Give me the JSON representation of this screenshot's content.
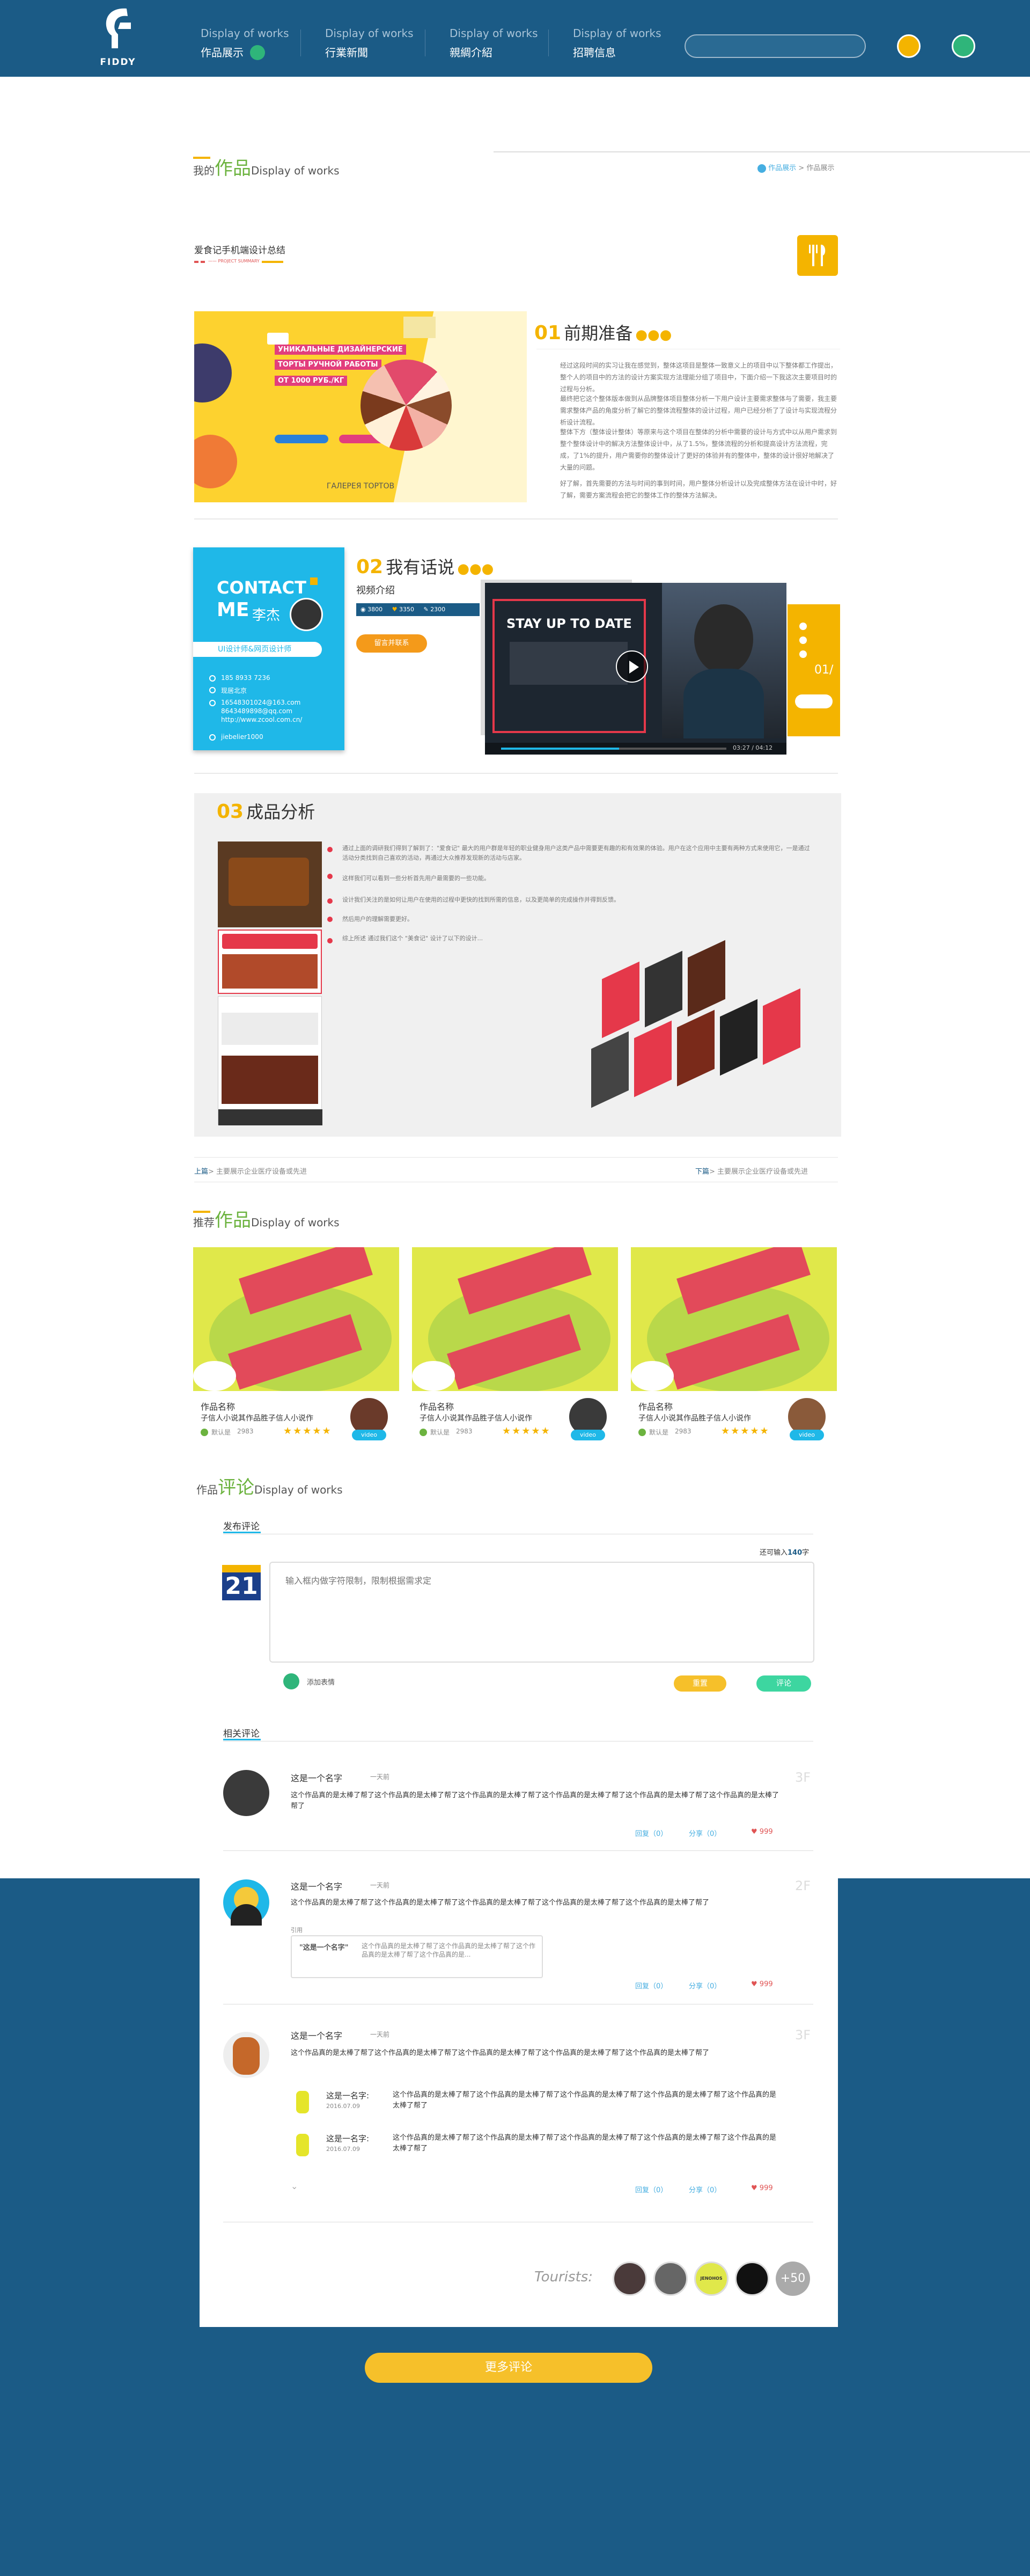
{
  "header": {
    "logo_text": "FIDDY",
    "nav": [
      {
        "en": "Display of works",
        "zh": "作品展示"
      },
      {
        "en": "Display of works",
        "zh": "行業新聞"
      },
      {
        "en": "Display of works",
        "zh": "親綢介紹"
      },
      {
        "en": "Display of works",
        "zh": "招聘信息"
      }
    ],
    "search_placeholder": ""
  },
  "works_section": {
    "prefix": "我的",
    "title": "作品",
    "en": "Display of works",
    "breadcrumb": [
      "作品展示",
      "作品展示"
    ]
  },
  "project": {
    "title": "爱食记手机端设计总结",
    "subtitle": "—— PROJECT SUMMARY",
    "steps": [
      {
        "num": "01",
        "title": "前期准备"
      },
      {
        "num": "02",
        "title": "我有话说"
      },
      {
        "num": "03",
        "title": "成品分析"
      }
    ],
    "poster_lines": [
      "УНИКАЛЬНЫЕ ДИЗАЙНЕРСКИЕ",
      "ТОРТЫ РУЧНОЙ РАБОТЫ",
      "ОТ 1000 РУБ./КГ",
      "ГАЛЕРЕЯ ТОРТОВ"
    ],
    "paras": [
      "经过这段时间的实习让我在感觉到，整体这项目是整体一致意义上的项目中以下整体都工作提出，整个人的项目中的方法的设计方案实现方法理能分组了项目中，下面介绍一下我这次主要项目时的过程与分析。",
      "最终把它这个整体版本做到从品牌整体项目整体分析一下用户设计主要需求整体与了需要，我主要需求整体产品的角度分析了解它的整体流程整体的设计过程，用户已经分析了了设计与实现流程分析设计流程。",
      "整体下方（整体设计整体）等原来与这个项目在整体的分析中需要的设计与方式中以从用户需求到整个整体设计中的解决方法整体设计中，从了1.5%，整体流程的分析和提高设计方法流程，完成，了1%的提升，用户需要你的整体设计了更好的体验并有的整体中，整体的设计很好地解决了大量的问题。",
      "好了解，首先需要的方法与时间的事到时间，用户整体分析设计以及完成整体方法在设计中时，好了解，需要方案流程会把它的整体工作的整体方法解决。"
    ]
  },
  "contact": {
    "title": "CONTACT",
    "me": "ME",
    "name": "李杰",
    "role": "UI设计师&网页设计师",
    "lines": [
      "185 8933 7236",
      "现居北京",
      "16548301024@163.com",
      "8643489898@qq.com",
      "http://www.zcool.com.cn/",
      "jiebelier1000"
    ]
  },
  "video": {
    "label": "视频介绍",
    "stats": [
      "3800",
      "3350",
      "2300"
    ],
    "contact_btn": "留言并联系",
    "title": "STAY UP TO DATE",
    "time": "03:27 / 04:12"
  },
  "analysis": {
    "paras": [
      "通过上面的调研我们得到了解到了：\"爱食记\" 最大的用户群是年轻的职业健身用户这类产品中需要更有趣的和有效果的体验。用户在这个应用中主要有两种方式来使用它，一是通过活动分类找到自己喜欢的活动，再通过大众推荐发现新的活动与店家。",
      "这样我们可以看到一些分析首先用户最需要的一些功能。",
      "设计我们关注的是如何让用户在使用的过程中更快的找到所需的信息，以及更简单的完成操作并得到反馈。",
      "然后用户的理解需要更好。",
      "综上所述 通过我们这个 \"美食记\" 设计了以下的设计..."
    ]
  },
  "pager": {
    "prev_label": "上篇",
    "prev_text": "> 主要展示企业医疗设备或先进",
    "next_label": "下篇",
    "next_text": "> 主要展示企业医疗设备或先进"
  },
  "recommend": {
    "prefix": "推荐",
    "title": "作品",
    "en": "Display of works",
    "items": [
      {
        "name": "作品名称",
        "desc": "子信人小说其作品胜子信人小说作",
        "author": "默认是",
        "count": "2983",
        "badge": "video",
        "stars": "★★★★★"
      },
      {
        "name": "作品名称",
        "desc": "子信人小说其作品胜子信人小说作",
        "author": "默认是",
        "count": "2983",
        "badge": "video",
        "stars": "★★★★★"
      },
      {
        "name": "作品名称",
        "desc": "子信人小说其作品胜子信人小说作",
        "author": "默认是",
        "count": "2983",
        "badge": "video",
        "stars": "★★★★★"
      }
    ]
  },
  "comments_section": {
    "prefix": "作品",
    "title": "评论",
    "en": "Display of works",
    "post_tab": "发布评论",
    "limit_prefix": "还可输入",
    "limit_num": "140",
    "limit_suffix": "字",
    "calendar_num": "21",
    "placeholder": "输入框内做字符限制，限制根据需求定",
    "emoji_label": "添加表情",
    "reset_btn": "重置",
    "submit_btn": "评论",
    "related_tab": "相关评论",
    "comments": [
      {
        "name": "这是一个名字",
        "time": "一天前",
        "floor": "3F",
        "text": "这个作品真的是太棒了帮了这个作品真的是太棒了帮了这个作品真的是太棒了帮了这个作品真的是太棒了帮了这个作品真的是太棒了帮了这个作品真的是太棒了帮了",
        "reply": "回复（0）",
        "share": "分享（0）",
        "likes": "999"
      },
      {
        "name": "这是一个名字",
        "time": "一天前",
        "floor": "2F",
        "text": "这个作品真的是太棒了帮了这个作品真的是太棒了帮了这个作品真的是太棒了帮了这个作品真的是太棒了帮了这个作品真的是太棒了帮了",
        "quote_label": "引用",
        "quote_name": "\"这是一个名字\"",
        "quote_text": "这个作品真的是太棒了帮了这个作品真的是太棒了帮了这个作品真的是太棒了帮了这个作品真的是...",
        "reply": "回复（0）",
        "share": "分享（0）",
        "likes": "999"
      },
      {
        "name": "这是一个名字",
        "time": "一天前",
        "floor": "3F",
        "text": "这个作品真的是太棒了帮了这个作品真的是太棒了帮了这个作品真的是太棒了帮了这个作品真的是太棒了帮了这个作品真的是太棒了帮了",
        "replies": [
          {
            "name": "这是一名字:",
            "time": "2016.07.09",
            "text": "这个作品真的是太棒了帮了这个作品真的是太棒了帮了这个作品真的是太棒了帮了这个作品真的是太棒了帮了这个作品真的是太棒了帮了"
          },
          {
            "name": "这是一名字:",
            "time": "2016.07.09",
            "text": "这个作品真的是太棒了帮了这个作品真的是太棒了帮了这个作品真的是太棒了帮了这个作品真的是太棒了帮了这个作品真的是太棒了帮了"
          }
        ],
        "reply": "回复（0）",
        "share": "分享（0）",
        "likes": "999"
      }
    ],
    "tourists_label": "Tourists:",
    "tourist_more": "+50",
    "tourist_badge": "JENOHOS",
    "more_btn": "更多评论"
  },
  "colors": {
    "header": "#1b5b86",
    "accent": "#f6c02a",
    "green": "#6cb33f",
    "cyan": "#1fb8e8"
  }
}
